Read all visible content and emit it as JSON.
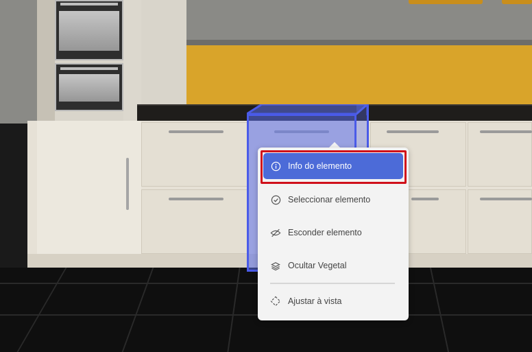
{
  "colors": {
    "accent": "#4c6bd8",
    "highlight_box": "#4a5be8",
    "annotation_outline": "#d0101a"
  },
  "context_menu": {
    "items": [
      {
        "label": "Info do elemento",
        "icon": "info-icon",
        "active": true
      },
      {
        "label": "Seleccionar elemento",
        "icon": "check-circle-icon",
        "active": false
      },
      {
        "label": "Esconder elemento",
        "icon": "eye-slash-icon",
        "active": false
      },
      {
        "label": "Ocultar Vegetal",
        "icon": "layers-icon",
        "active": false
      },
      {
        "label": "Ajustar à vista",
        "icon": "fit-view-icon",
        "active": false
      }
    ]
  }
}
